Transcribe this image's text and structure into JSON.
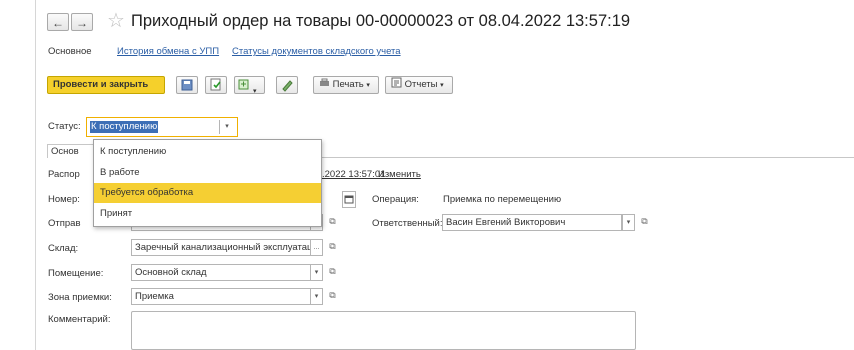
{
  "window": {
    "title": "Приходный ордер на товары 00-00000023 от 08.04.2022 13:57:19",
    "nav_back": "←",
    "nav_forward": "→",
    "star": "☆"
  },
  "top_tabs": {
    "main": "Основное",
    "history": "История обмена с УПП",
    "statuses": "Статусы документов складского учета"
  },
  "toolbar": {
    "post_close": "Провести и закрыть",
    "print": "Печать",
    "reports": "Отчеты",
    "dropdown_arrow": "▾"
  },
  "status": {
    "label": "Статус:",
    "value": "К поступлению",
    "arrow": "▾"
  },
  "tab": {
    "main_clipped": "Основ"
  },
  "dropdown": {
    "items": [
      "К поступлению",
      "В работе",
      "Требуется обработка",
      "Принят"
    ],
    "selected_index": 2
  },
  "form": {
    "distribution_label_clipped": "Распор",
    "distribution_date": ".2022 13:57:01",
    "change_link": "Изменить",
    "number_label_clipped": "Номер:",
    "operation_label": "Операция:",
    "operation_value": "Приемка по перемещению",
    "sender_label_clipped": "Отправ",
    "responsible_label": "Ответственный:",
    "responsible_value": "Васин Евгений Викторович",
    "warehouse_label": "Склад:",
    "warehouse_value": "Заречный канализационный эксплуатац",
    "warehouse_ellipsis": "...",
    "room_label": "Помещение:",
    "room_value": "Основной склад",
    "zone_label": "Зона приемки:",
    "zone_value": "Приемка",
    "comment_label": "Комментарий:",
    "open_icon": "⧉"
  }
}
